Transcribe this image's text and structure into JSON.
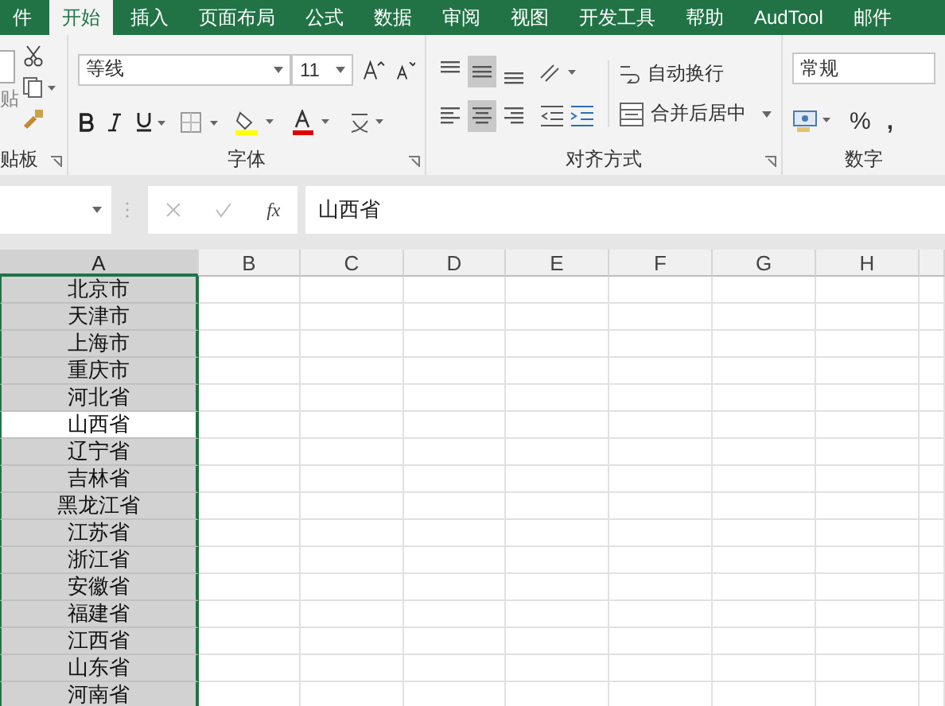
{
  "tabs": [
    {
      "label": "件",
      "selected": false
    },
    {
      "label": "开始",
      "selected": true
    },
    {
      "label": "插入",
      "selected": false
    },
    {
      "label": "页面布局",
      "selected": false
    },
    {
      "label": "公式",
      "selected": false
    },
    {
      "label": "数据",
      "selected": false
    },
    {
      "label": "审阅",
      "selected": false
    },
    {
      "label": "视图",
      "selected": false
    },
    {
      "label": "开发工具",
      "selected": false
    },
    {
      "label": "帮助",
      "selected": false
    },
    {
      "label": "AudTool",
      "selected": false
    },
    {
      "label": "邮件",
      "selected": false
    }
  ],
  "clipboard": {
    "paste_label": "贴",
    "group_label": "贴板"
  },
  "font": {
    "family": "等线",
    "size": "11",
    "group_label": "字体"
  },
  "alignment": {
    "buttons": [
      {
        "kind": "top",
        "selected": false
      },
      {
        "kind": "middle",
        "selected": true
      },
      {
        "kind": "bottom",
        "selected": false
      },
      {
        "kind": "left",
        "selected": false
      },
      {
        "kind": "center",
        "selected": true
      },
      {
        "kind": "right",
        "selected": false
      }
    ],
    "wrap_label": "自动换行",
    "merge_label": "合并后居中",
    "group_label": "对齐方式"
  },
  "number": {
    "format": "常规",
    "percent": "%",
    "comma": ",",
    "group_label": "数字"
  },
  "formula_bar": {
    "fx": "fx",
    "value": "山西省"
  },
  "sheet": {
    "columns": [
      {
        "label": "A",
        "selected": true
      },
      {
        "label": "B",
        "selected": false
      },
      {
        "label": "C",
        "selected": false
      },
      {
        "label": "D",
        "selected": false
      },
      {
        "label": "E",
        "selected": false
      },
      {
        "label": "F",
        "selected": false
      },
      {
        "label": "G",
        "selected": false
      },
      {
        "label": "H",
        "selected": false
      }
    ],
    "rows": [
      {
        "value": "北京市",
        "selected": false
      },
      {
        "value": "天津市",
        "selected": false
      },
      {
        "value": "上海市",
        "selected": false
      },
      {
        "value": "重庆市",
        "selected": false
      },
      {
        "value": "河北省",
        "selected": false
      },
      {
        "value": "山西省",
        "selected": true
      },
      {
        "value": "辽宁省",
        "selected": false
      },
      {
        "value": "吉林省",
        "selected": false
      },
      {
        "value": "黑龙江省",
        "selected": false
      },
      {
        "value": "江苏省",
        "selected": false
      },
      {
        "value": "浙江省",
        "selected": false
      },
      {
        "value": "安徽省",
        "selected": false
      },
      {
        "value": "福建省",
        "selected": false
      },
      {
        "value": "江西省",
        "selected": false
      },
      {
        "value": "山东省",
        "selected": false
      },
      {
        "value": "河南省",
        "selected": false
      }
    ]
  }
}
